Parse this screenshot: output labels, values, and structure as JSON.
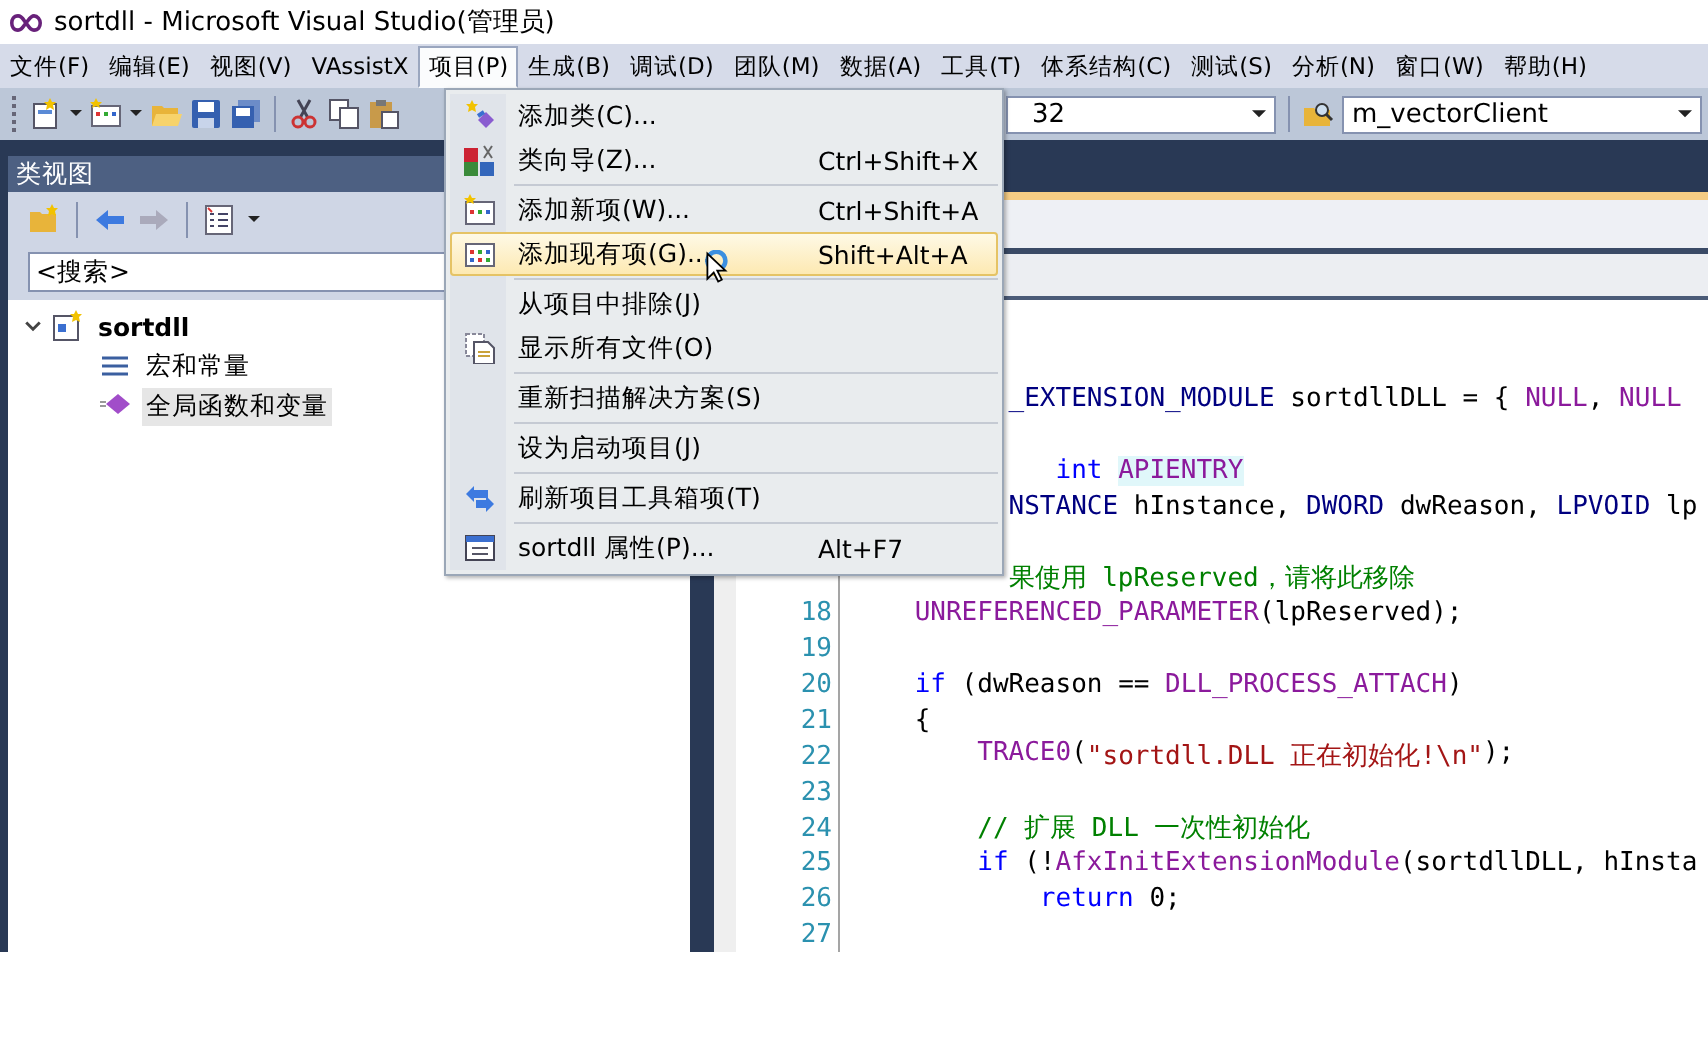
{
  "window": {
    "title": "sortdll - Microsoft Visual Studio(管理员)"
  },
  "menubar": [
    {
      "label": "文件(F)",
      "selected": false
    },
    {
      "label": "编辑(E)",
      "selected": false
    },
    {
      "label": "视图(V)",
      "selected": false
    },
    {
      "label": "VAssistX",
      "selected": false
    },
    {
      "label": "项目(P)",
      "selected": true
    },
    {
      "label": "生成(B)",
      "selected": false
    },
    {
      "label": "调试(D)",
      "selected": false
    },
    {
      "label": "团队(M)",
      "selected": false
    },
    {
      "label": "数据(A)",
      "selected": false
    },
    {
      "label": "工具(T)",
      "selected": false
    },
    {
      "label": "体系结构(C)",
      "selected": false
    },
    {
      "label": "测试(S)",
      "selected": false
    },
    {
      "label": "分析(N)",
      "selected": false
    },
    {
      "label": "窗口(W)",
      "selected": false
    },
    {
      "label": "帮助(H)",
      "selected": false
    }
  ],
  "toolbar": {
    "platform_combo": {
      "value": "32"
    },
    "startup_combo": {
      "value": "m_vectorClient"
    }
  },
  "class_view": {
    "title": "类视图",
    "search": {
      "value": "<搜索>"
    },
    "tree": [
      {
        "label": "sortdll",
        "expanded": true,
        "selected": false,
        "children": [
          {
            "label": "宏和常量",
            "selected": false
          },
          {
            "label": "全局函数和变量",
            "selected": true
          }
        ]
      }
    ]
  },
  "project_menu": [
    {
      "label": "添加类(C)...",
      "selected": false,
      "separator_before": false
    },
    {
      "label": "类向导(Z)...",
      "shortcut": "Ctrl+Shift+X",
      "selected": false,
      "separator_before": false
    },
    {
      "label": "添加新项(W)...",
      "shortcut": "Ctrl+Shift+A",
      "selected": false,
      "separator_before": true
    },
    {
      "label": "添加现有项(G)...",
      "shortcut": "Shift+Alt+A",
      "selected": true,
      "separator_before": false
    },
    {
      "label": "从项目中排除(J)",
      "selected": false,
      "separator_before": true
    },
    {
      "label": "显示所有文件(O)",
      "selected": false,
      "separator_before": false
    },
    {
      "label": "重新扫描解决方案(S)",
      "selected": false,
      "separator_before": true
    },
    {
      "label": "设为启动项目(J)",
      "selected": false,
      "separator_before": true
    },
    {
      "label": "刷新项目工具箱项(T)",
      "selected": false,
      "separator_before": true
    },
    {
      "label": "sortdll 属性(P)...",
      "shortcut": "Alt+F7",
      "selected": false,
      "separator_before": true
    }
  ],
  "code_lines": [
    {
      "segments": [
        {
          "kind": "type",
          "text": "          _EXTENSION_MODULE"
        },
        {
          "kind": "plain",
          "text": " sortdllDLL = { "
        },
        {
          "kind": "macro",
          "text": "NULL"
        },
        {
          "kind": "plain",
          "text": ", "
        },
        {
          "kind": "macro",
          "text": "NULL"
        }
      ]
    },
    {
      "segments": [
        {
          "kind": "keyword",
          "text": "             int"
        },
        {
          "kind": "highlight",
          "text": " APIENTRY"
        }
      ]
    },
    {
      "segments": [
        {
          "kind": "type",
          "text": "          NSTANCE"
        },
        {
          "kind": "plain",
          "text": " hInstance, "
        },
        {
          "kind": "type",
          "text": "DWORD"
        },
        {
          "kind": "plain",
          "text": " dwReason, "
        },
        {
          "kind": "type",
          "text": "LPVOID"
        },
        {
          "kind": "plain",
          "text": " lp"
        }
      ]
    },
    {
      "segments": [
        {
          "kind": "comment",
          "text": "          果使用 lpReserved，请将此移除"
        }
      ]
    },
    {
      "number": "18",
      "segments": [
        {
          "kind": "macro",
          "text": "    UNREFERENCED_PARAMETER"
        },
        {
          "kind": "plain",
          "text": "(lpReserved);"
        }
      ]
    },
    {
      "number": "19"
    },
    {
      "number": "20",
      "segments": [
        {
          "kind": "keyword",
          "text": "    if"
        },
        {
          "kind": "plain",
          "text": " (dwReason == "
        },
        {
          "kind": "macro",
          "text": "DLL_PROCESS_ATTACH"
        },
        {
          "kind": "plain",
          "text": ")"
        }
      ]
    },
    {
      "number": "21",
      "segments": [
        {
          "kind": "plain",
          "text": "    {"
        }
      ]
    },
    {
      "number": "22",
      "segments": [
        {
          "kind": "macro",
          "text": "        TRACE0"
        },
        {
          "kind": "plain",
          "text": "("
        },
        {
          "kind": "string",
          "text": "\"sortdll.DLL 正在初始化!\\n\""
        },
        {
          "kind": "plain",
          "text": ");"
        }
      ]
    },
    {
      "number": "23"
    },
    {
      "number": "24",
      "segments": [
        {
          "kind": "comment",
          "text": "        // 扩展 DLL 一次性初始化"
        }
      ]
    },
    {
      "number": "25",
      "segments": [
        {
          "kind": "keyword",
          "text": "        if"
        },
        {
          "kind": "plain",
          "text": " (!"
        },
        {
          "kind": "macro",
          "text": "AfxInitExtensionModule"
        },
        {
          "kind": "plain",
          "text": "(sortdllDLL, hInsta"
        }
      ]
    },
    {
      "number": "26",
      "segments": [
        {
          "kind": "keyword",
          "text": "            return"
        },
        {
          "kind": "plain",
          "text": " 0;"
        }
      ]
    },
    {
      "number": "27"
    }
  ]
}
